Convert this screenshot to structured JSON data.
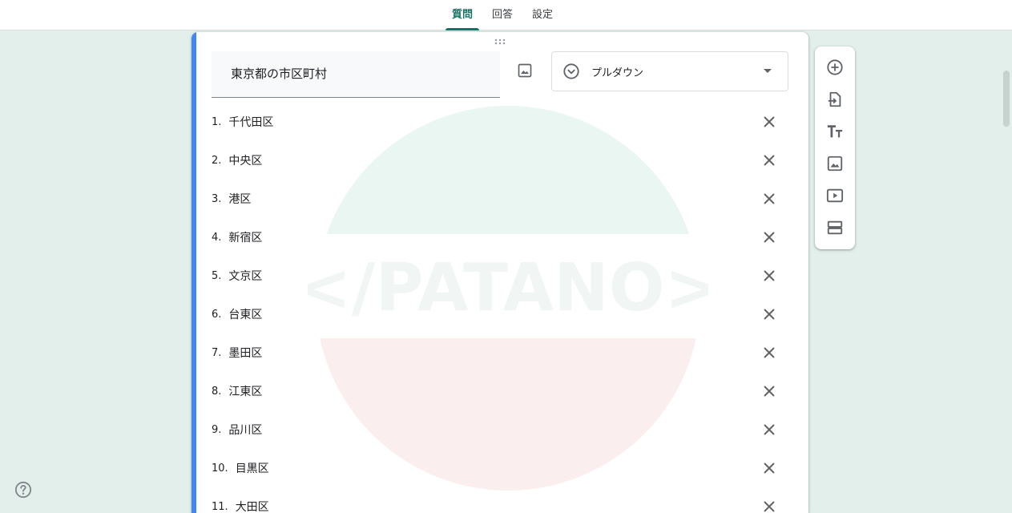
{
  "tabs": [
    {
      "label": "質問",
      "active": true
    },
    {
      "label": "回答",
      "active": false
    },
    {
      "label": "設定",
      "active": false
    }
  ],
  "question": {
    "title": "東京都の市区町村",
    "type_label": "プルダウン",
    "add_image_icon": "image-icon",
    "type_icon": "dropdown-circle-icon"
  },
  "options": [
    {
      "num": "1.",
      "label": "千代田区"
    },
    {
      "num": "2.",
      "label": "中央区"
    },
    {
      "num": "3.",
      "label": "港区"
    },
    {
      "num": "4.",
      "label": "新宿区"
    },
    {
      "num": "5.",
      "label": "文京区"
    },
    {
      "num": "6.",
      "label": "台東区"
    },
    {
      "num": "7.",
      "label": "墨田区"
    },
    {
      "num": "8.",
      "label": "江東区"
    },
    {
      "num": "9.",
      "label": "品川区"
    },
    {
      "num": "10.",
      "label": "目黒区"
    },
    {
      "num": "11.",
      "label": "大田区"
    }
  ],
  "toolbar": {
    "items": [
      "add-question-icon",
      "import-questions-icon",
      "add-title-icon",
      "add-image-icon",
      "add-video-icon",
      "add-section-icon"
    ]
  },
  "watermark": {
    "text": "</PATANO>"
  },
  "colors": {
    "accent": "#137565",
    "card_accent": "#4285f4",
    "background": "#e3efeb"
  }
}
